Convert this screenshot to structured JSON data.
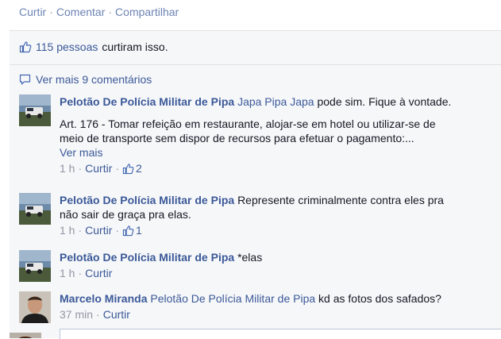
{
  "post_actions": {
    "like": "Curtir",
    "comment": "Comentar",
    "share": "Compartilhar"
  },
  "likes": {
    "count_label": "115 pessoas",
    "suffix": "curtiram isso."
  },
  "view_more": "Ver mais 9 comentários",
  "comments": [
    {
      "author": "Pelotão De Polícia Militar de Pipa",
      "mention": "Japa Pipa Japa",
      "text": "pode sim. Fique à vontade.",
      "text2_line1": "Art. 176 - Tomar refeição em restaurante, alojar-se em hotel ou utilizar-se de",
      "text2_line2": "meio de transporte sem dispor de recursos para efetuar o pagamento:...",
      "see_more": "Ver mais",
      "time": "1 h",
      "like": "Curtir",
      "like_count": "2"
    },
    {
      "author": "Pelotão De Polícia Militar de Pipa",
      "text_line1": "Represente criminalmente contra eles pra",
      "text_line2": "não sair de graça pra elas.",
      "time": "1 h",
      "like": "Curtir",
      "like_count": "1"
    },
    {
      "author": "Pelotão De Polícia Militar de Pipa",
      "text": "*elas",
      "time": "1 h",
      "like": "Curtir"
    },
    {
      "author": "Marcelo Miranda",
      "mention": "Pelotão De Polícia Militar de Pipa",
      "text": "kd as fotos dos safados?",
      "time": "37 min",
      "like": "Curtir"
    }
  ],
  "colors": {
    "link": "#3b5998",
    "muted": "#9197a3",
    "panel": "#f6f7f9",
    "border": "#e1e2e3"
  },
  "icons": {
    "like": "thumbs-up-icon",
    "comment": "speech-bubble-icon"
  }
}
